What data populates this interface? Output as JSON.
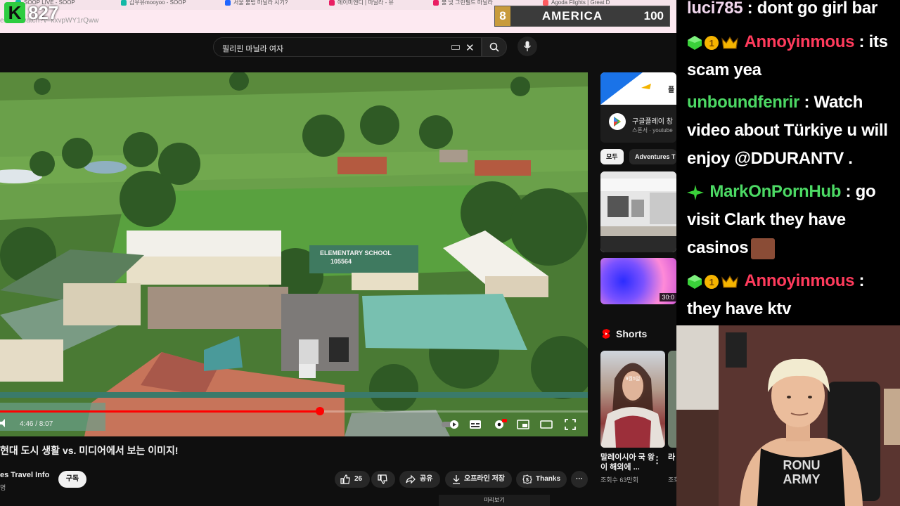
{
  "browser": {
    "tabs": [
      {
        "label": "SOOP LIVE - SOOP",
        "color": "#14b8a6"
      },
      {
        "label": "갑우유mooyoo - SOOP",
        "color": "#14b8a6"
      },
      {
        "label": "서울 불법 마닐라 시기?",
        "color": "#1e66ff"
      },
      {
        "label": "에이미엔디 | 마닐라 - 유",
        "color": "#e91e63"
      },
      {
        "label": "불 및 그린필드 마닐라",
        "color": "#e91e63"
      },
      {
        "label": "Agoda Flights | Great D",
        "color": "#ff5a5f"
      }
    ],
    "url": "e.com/watch?v=kxvpWY1rQww"
  },
  "overlay": {
    "viewer_logo": "K",
    "viewer_count": "827",
    "score_left": "8",
    "score_country": "AMERICA",
    "score_right": "100"
  },
  "youtube": {
    "search_query": "필리핀 마닐라 여자",
    "player": {
      "time": "4:46 / 8:07",
      "progress_percent": 54.4,
      "school_sign": "ELEMENTARY SCHOOL",
      "school_sign_sub": "105564"
    },
    "video_title": "현대 도시 생활 vs. 미디어에서 보는 이미지!",
    "channel_name": "es Travel Info",
    "channel_sub": "명",
    "subscribe_label": "구독",
    "like_count": "26",
    "share_label": "공유",
    "offline_label": "오프라인 저장",
    "thanks_label": "Thanks",
    "more_label": "···",
    "preview_label": "미리보기",
    "sidebar": {
      "ad_title": "구글플레이 창",
      "ad_sub": "스폰서 · youtube",
      "ad_banner_text": "플",
      "chips": [
        "모두",
        "Adventures T"
      ],
      "thumb2_duration": "30:0",
      "shorts_header": "Shorts",
      "short1_title": "말레이시아 국 왕이 해외에 ...",
      "short1_views": "조회수 63만회",
      "short1_overlay": "9월5일",
      "short2_title": "라 결",
      "short2_views": "조회"
    }
  },
  "chat": [
    {
      "user": "luci785",
      "user_color": "#f2d7ee",
      "text": " : dont go girl bar",
      "badges": []
    },
    {
      "user": "Annoyinmous",
      "user_color": "#ff3b5c",
      "text": " : its scam yea",
      "badges": [
        "green-gem",
        "gold-coin",
        "crown"
      ]
    },
    {
      "user": "unboundfenrir",
      "user_color": "#4cd964",
      "text": " : Watch video about Türkiye u will enjoy @DDURANTV .",
      "badges": []
    },
    {
      "user": "MarkOnPornHub",
      "user_color": "#4cd964",
      "text": " : go visit Clark they have casinos",
      "badges": [
        "green-star"
      ],
      "emote": true
    },
    {
      "user": "Annoyinmous",
      "user_color": "#ff3b5c",
      "text": " : they have ktv",
      "badges": [
        "green-gem",
        "gold-coin",
        "crown"
      ]
    }
  ],
  "webcam": {
    "shirt_text_1": "RONU",
    "shirt_text_2": "ARMY"
  },
  "colors": {
    "accent_red": "#ff0000",
    "page_bg": "#0f0f0f",
    "chat_bg": "#000000"
  }
}
